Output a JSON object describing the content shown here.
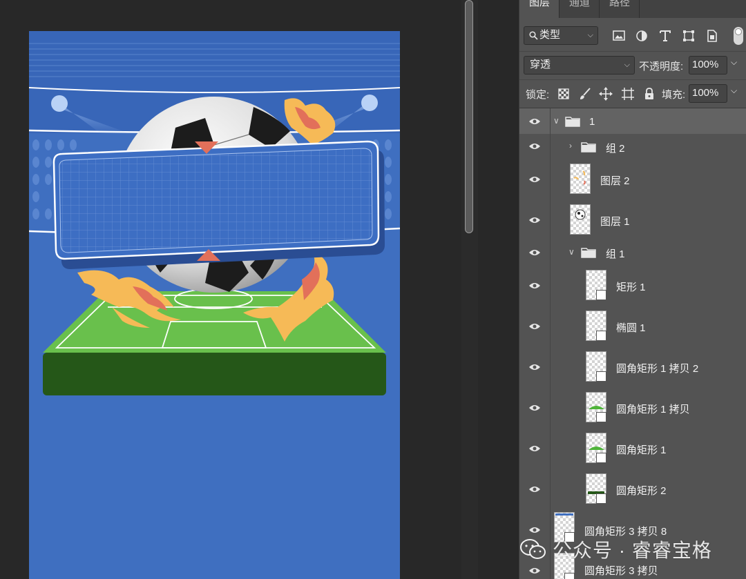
{
  "tabs": [
    {
      "label": "图层",
      "active": true
    },
    {
      "label": "通道",
      "active": false
    },
    {
      "label": "路径",
      "active": false
    }
  ],
  "filter": {
    "kind_label": "类型",
    "icons": [
      "image-filter-icon",
      "adjustment-filter-icon",
      "text-filter-icon",
      "shape-filter-icon",
      "smart-object-filter-icon"
    ]
  },
  "blend": {
    "mode": "穿透",
    "opacity_label": "不透明度:",
    "opacity_value": "100%"
  },
  "lock": {
    "label": "锁定:",
    "icons": [
      "lock-transparent-icon",
      "lock-paint-icon",
      "lock-position-icon",
      "lock-artboard-icon",
      "lock-all-icon"
    ],
    "fill_label": "填充:",
    "fill_value": "100%"
  },
  "layers": [
    {
      "name": "1",
      "type": "group",
      "expanded": true,
      "selected": true
    },
    {
      "name": "组 2",
      "type": "group",
      "expanded": false
    },
    {
      "name": "图层 2",
      "type": "pixel"
    },
    {
      "name": "图层 1",
      "type": "pixel"
    },
    {
      "name": "组 1",
      "type": "group",
      "expanded": true
    },
    {
      "name": "矩形 1",
      "type": "shape"
    },
    {
      "name": "椭圆 1",
      "type": "shape"
    },
    {
      "name": "圆角矩形 1 拷贝 2",
      "type": "shape"
    },
    {
      "name": "圆角矩形 1 拷贝",
      "type": "shape"
    },
    {
      "name": "圆角矩形 1",
      "type": "shape"
    },
    {
      "name": "圆角矩形 2",
      "type": "shape"
    },
    {
      "name": "圆角矩形 3 拷贝 8",
      "type": "shape"
    },
    {
      "name": "圆角矩形 3 拷贝",
      "type": "shape"
    }
  ],
  "watermark": {
    "text": "公众号 · 睿睿宝格"
  },
  "colors": {
    "canvas_bg": "#282828",
    "panel_bg": "#535353",
    "artwork_blue": "#3f6fc0",
    "field_green": "#69c04c",
    "field_side": "#255718",
    "flame_orange": "#f6ba57",
    "marker_red": "#e2705a"
  }
}
